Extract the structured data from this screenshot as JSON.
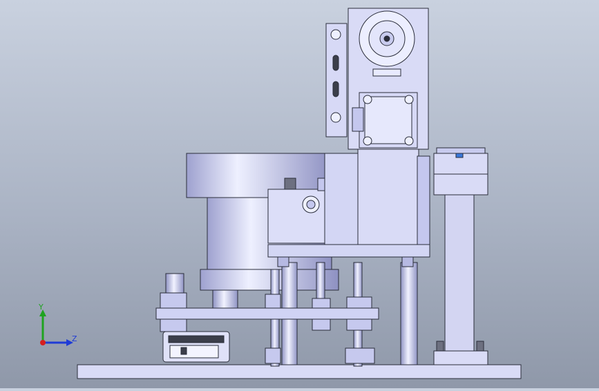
{
  "viewport": {
    "background_top": "#c9d1df",
    "background_bottom": "#8f98a9",
    "part_fill": "#d9dbf6",
    "part_fill_dark": "#b9bce6",
    "edge_color": "#2a2d3a"
  },
  "triad": {
    "y_label": "Y",
    "z_label": "Z",
    "y_color": "#1fa31f",
    "z_color": "#1f3bd6",
    "x_color": "#d61f1f"
  }
}
